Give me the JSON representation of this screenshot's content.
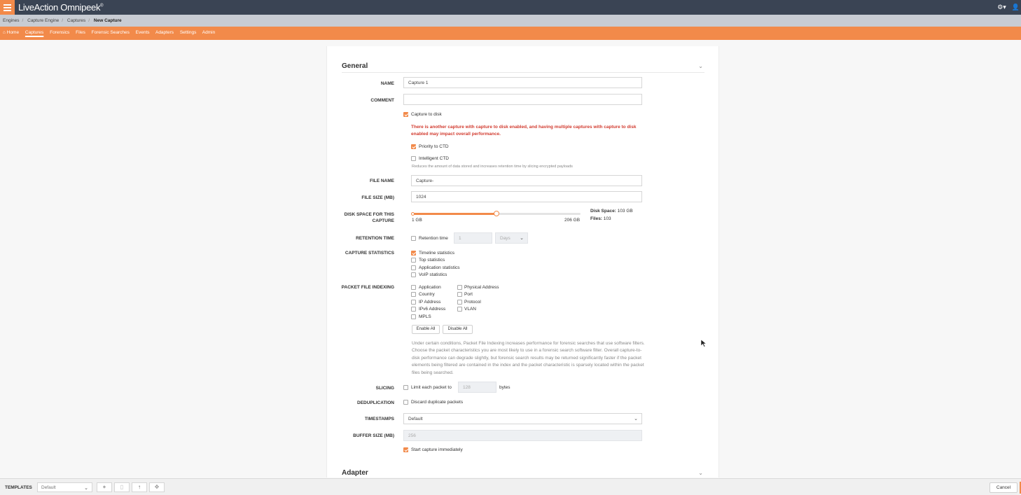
{
  "app": {
    "brand": "LiveAction Omnipeek",
    "brand_mark": "®"
  },
  "breadcrumb": [
    "Engines",
    "Capture Engine",
    "Captures",
    "New Capture"
  ],
  "nav": [
    "Home",
    "Captures",
    "Forensics",
    "Files",
    "Forensic Searches",
    "Events",
    "Adapters",
    "Settings",
    "Admin"
  ],
  "nav_active": "Captures",
  "colors": {
    "accent": "#f28a4a",
    "topbar": "#3a4454",
    "warning": "#d23b2f"
  },
  "icons": {
    "menu": "hamburger-icon",
    "settings": "gear-icon",
    "user": "user-icon",
    "home": "home-icon"
  },
  "general": {
    "title": "General",
    "name_label": "NAME",
    "name_value": "Capture 1",
    "comment_label": "COMMENT",
    "comment_value": "",
    "capture_to_disk": {
      "label": "Capture to disk",
      "checked": true
    },
    "warning": "There is another capture with capture to disk enabled, and having multiple captures with capture to disk enabled may impact overall performance.",
    "priority_ctd": {
      "label": "Priority to CTD",
      "checked": true
    },
    "intelligent_ctd": {
      "label": "Intelligent CTD",
      "checked": false
    },
    "intelligent_hint": "Reduces the amount of data stored and increases retention time by slicing encrypted payloads",
    "file_name_label": "FILE NAME",
    "file_name_value": "Capture-",
    "file_size_label": "FILE SIZE (MB)",
    "file_size_value": "1024",
    "disk_space_label": "DISK SPACE FOR THIS CAPTURE",
    "disk_space": {
      "min_label": "1 GB",
      "max_label": "206 GB",
      "fraction": 0.5,
      "disk_space_key": "Disk Space:",
      "disk_space_value": "103 GB",
      "files_key": "Files:",
      "files_value": "103"
    },
    "retention_label": "RETENTION TIME",
    "retention": {
      "label": "Retention time",
      "checked": false,
      "value": "1",
      "unit": "Days"
    },
    "capture_stats_label": "CAPTURE STATISTICS",
    "capture_stats": [
      {
        "label": "Timeline statistics",
        "checked": true
      },
      {
        "label": "Top statistics",
        "checked": false
      },
      {
        "label": "Application statistics",
        "checked": false
      },
      {
        "label": "VoIP statistics",
        "checked": false
      }
    ],
    "indexing_label": "PACKET FILE INDEXING",
    "indexing_col1": [
      "Application",
      "Country",
      "IP Address",
      "IPv6 Address",
      "MPLS"
    ],
    "indexing_col2": [
      "Physical Address",
      "Port",
      "Protocol",
      "VLAN"
    ],
    "enable_all": "Enable All",
    "disable_all": "Disable All",
    "indexing_info": "Under certain conditions, Packet File Indexing increases performance for forensic searches that use software filters. Choose the packet characteristics you are most likely to use in a forensic search software filter. Overall capture-to-disk performance can degrade slightly, but forensic search results may be returned significantly faster if the packet elements being filtered are contained in the index and the packet characteristic is sparsely located within the packet files being searched.",
    "slicing_label": "SLICING",
    "slicing": {
      "label": "Limit each packet to",
      "checked": false,
      "value": "128",
      "unit": "bytes"
    },
    "dedup_label": "DEDUPLICATION",
    "dedup": {
      "label": "Discard duplicate packets",
      "checked": false
    },
    "timestamps_label": "TIMESTAMPS",
    "timestamps_value": "Default",
    "buffer_label": "BUFFER SIZE (MB)",
    "buffer_value": "256",
    "start_immediately": {
      "label": "Start capture immediately",
      "checked": true
    }
  },
  "adapter": {
    "title": "Adapter"
  },
  "footer": {
    "templates_label": "TEMPLATES",
    "template_value": "Default",
    "cancel": "Cancel"
  }
}
